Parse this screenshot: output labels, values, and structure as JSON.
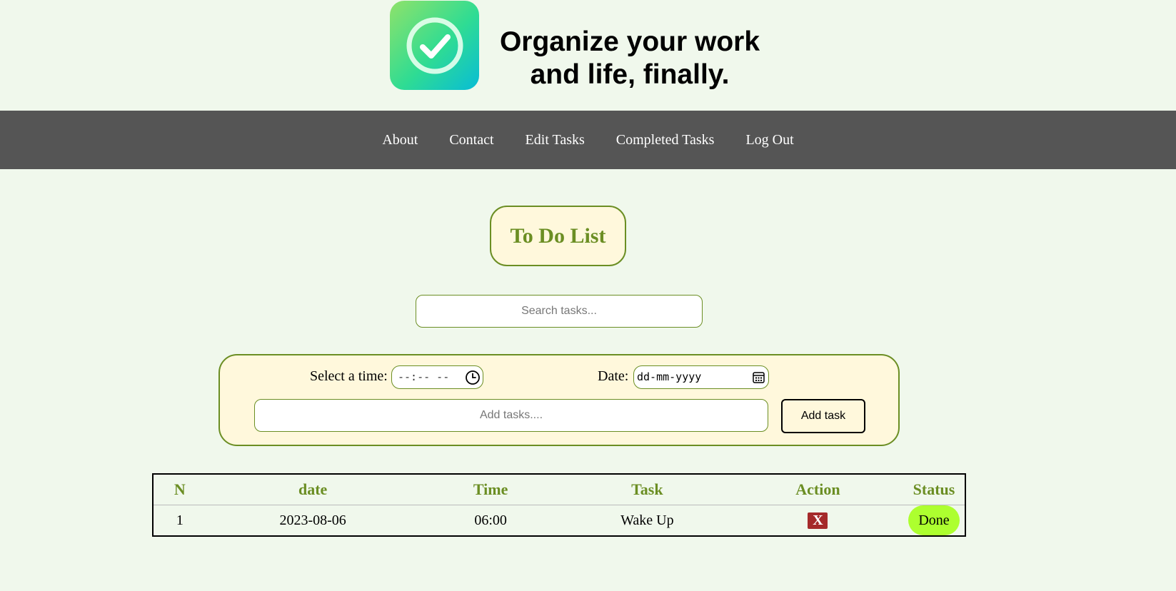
{
  "header": {
    "logo_icon": "check-circle-icon",
    "slogan_line1": "Organize your work",
    "slogan_line2": "and life, finally."
  },
  "nav": {
    "items": [
      {
        "label": "About"
      },
      {
        "label": "Contact"
      },
      {
        "label": "Edit Tasks"
      },
      {
        "label": "Completed Tasks"
      },
      {
        "label": "Log Out"
      }
    ]
  },
  "main": {
    "title": "To Do List",
    "search_placeholder": "Search tasks...",
    "time_label": "Select a time:",
    "time_placeholder": "--:-- --",
    "date_label": "Date:",
    "date_placeholder": "dd-mm-yyyy",
    "add_placeholder": "Add tasks....",
    "add_button_label": "Add task"
  },
  "table": {
    "headers": {
      "n": "N",
      "date": "date",
      "time": "Time",
      "task": "Task",
      "action": "Action",
      "status": "Status"
    },
    "rows": [
      {
        "n": "1",
        "date": "2023-08-06",
        "time": "06:00",
        "task": "Wake Up",
        "action_label": "X",
        "status_label": "Done"
      }
    ]
  },
  "colors": {
    "accent": "#6b8e23",
    "navbar": "#555555",
    "background": "#f0f8ec",
    "panel": "#fff8dc",
    "delete": "#a52a2a",
    "done": "#adff2f"
  }
}
